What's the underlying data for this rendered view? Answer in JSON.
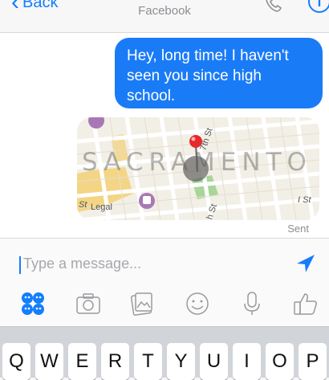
{
  "nav": {
    "back_label": "Back",
    "subtitle": "Facebook"
  },
  "message": {
    "text": "Hey, long time! I haven't seen you since high school.",
    "status": "Sent"
  },
  "map": {
    "city_label": "SACRAMENTO",
    "street_legal": "Legal",
    "street_st": "St",
    "street_i_st": "I St",
    "street_7th": "7th St",
    "street_6th": "h St"
  },
  "composer": {
    "placeholder": "Type a message..."
  },
  "toolbar_icons": [
    "stickers-icon",
    "camera-icon",
    "gallery-icon",
    "emoji-icon",
    "microphone-icon",
    "like-icon"
  ],
  "keyboard": {
    "row1": [
      "Q",
      "W",
      "E",
      "R",
      "T",
      "Y",
      "U",
      "I",
      "O",
      "P"
    ]
  },
  "colors": {
    "accent": "#147efb",
    "bubble": "#1a7bf7",
    "pin": "#e62a2a"
  }
}
